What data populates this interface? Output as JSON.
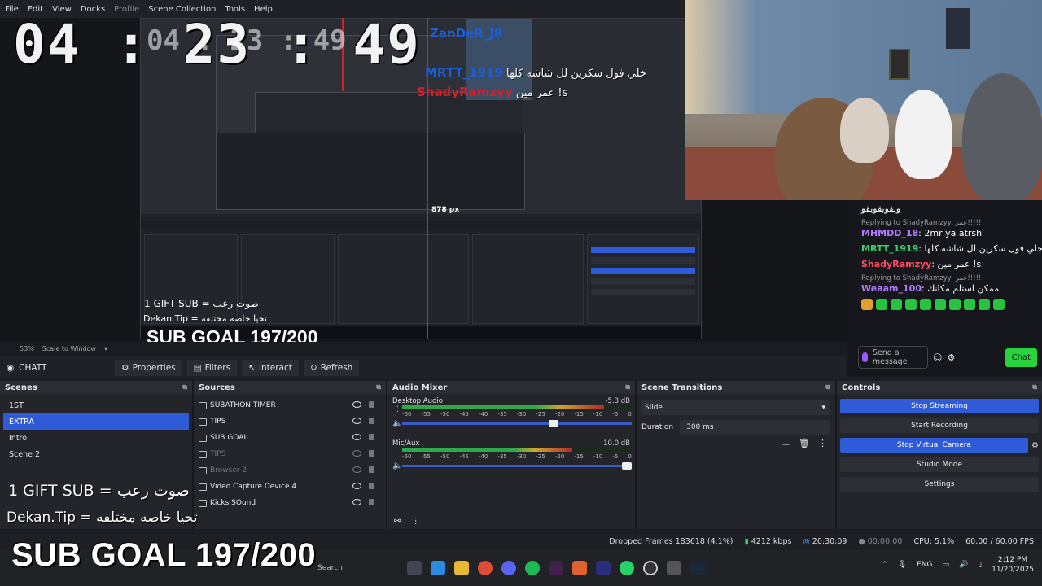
{
  "menu": [
    "File",
    "Edit",
    "View",
    "Docks",
    "Profile",
    "Scene Collection",
    "Tools",
    "Help"
  ],
  "overlay": {
    "timer": "04 : 23 : 49",
    "timer_ghost": "04 : 23 : 49",
    "chat": [
      {
        "name": "ZanDeR_J8",
        "msg": ""
      },
      {
        "name": "MRTT_1919",
        "msg": "خلي فول سكرين لل شاشه كلها"
      },
      {
        "name": "ShadyRamzyy",
        "msg": "عمر مين !s"
      }
    ],
    "gift": "1 GIFT SUB = صوت رعب",
    "tip": "Dekan.Tip = تحيا خاصه مختلفه",
    "goal": "SUB GOAL 197/200",
    "px_label": "878 px"
  },
  "chat": {
    "top_text": "وبقويقويقو",
    "items": [
      {
        "reply": "Replying to ShadyRamzyy: عمر!!!!!",
        "user": "MHMDD_18",
        "color": "purple",
        "text": ": 2mr ya atrsh"
      },
      {
        "reply": "",
        "user": "MRTT_1919",
        "color": "green",
        "text": ": خلي فول سكرين لل شاشه كلها"
      },
      {
        "reply": "",
        "user": "ShadyRamzyy",
        "color": "red",
        "text": ": عمر مين !s"
      },
      {
        "reply": "Replying to ShadyRamzyy: عمر!!!!!",
        "user": "Weaam_100",
        "color": "purple",
        "text": ": ممكن استلم مكانك"
      }
    ],
    "send_placeholder": "Send a message",
    "chat_button": "Chat"
  },
  "zoom": {
    "value": "53%",
    "mode": "Scale to Window"
  },
  "source_toolbar": {
    "name": "CHATT",
    "properties": "Properties",
    "filters": "Filters",
    "interact": "Interact",
    "refresh": "Refresh"
  },
  "scenes": {
    "title": "Scenes",
    "items": [
      "1ST",
      "EXTRA",
      "Intro",
      "Scene 2"
    ],
    "selected": 1
  },
  "sources": {
    "title": "Sources",
    "items": [
      {
        "label": "SUBATHON TIMER",
        "visible": true
      },
      {
        "label": "TIPS",
        "visible": true
      },
      {
        "label": "SUB GOAL",
        "visible": true
      },
      {
        "label": "TIPS",
        "visible": false
      },
      {
        "label": "Browser 2",
        "visible": false
      },
      {
        "label": "Video Capture Device 4",
        "visible": true
      },
      {
        "label": "Kicks SOund",
        "visible": true
      }
    ]
  },
  "mixer": {
    "title": "Audio Mixer",
    "channels": [
      {
        "name": "Desktop Audio",
        "db": "-5.3 dB",
        "level": 0.88,
        "volume": 0.68
      },
      {
        "name": "Mic/Aux",
        "db": "10.0 dB",
        "level": 0.74,
        "volume": 1.0
      }
    ],
    "ticks": [
      "-60",
      "-55",
      "-50",
      "-45",
      "-40",
      "-35",
      "-30",
      "-25",
      "-20",
      "-15",
      "-10",
      "-5",
      "0"
    ]
  },
  "transitions": {
    "title": "Scene Transitions",
    "selected": "Slide",
    "duration_label": "Duration",
    "duration_value": "300 ms"
  },
  "controls": {
    "title": "Controls",
    "buttons": [
      "Stop Streaming",
      "Start Recording",
      "Stop Virtual Camera",
      "Studio Mode",
      "Settings"
    ]
  },
  "status": {
    "dropped": "Dropped Frames 183618 (4.1%)",
    "bitrate": "4212 kbps",
    "live": "20:30:09",
    "rec": "00:00:00",
    "cpu": "CPU: 5.1%",
    "fps": "60.00 / 60.00 FPS"
  },
  "taskbar": {
    "lang": "ENG",
    "time": "2:12 PM",
    "date": "11/20/2025",
    "search": "Search"
  },
  "colors": {
    "accent": "#2f5bd8",
    "chat_green": "#27d43f",
    "live_red": "#d0222a"
  }
}
